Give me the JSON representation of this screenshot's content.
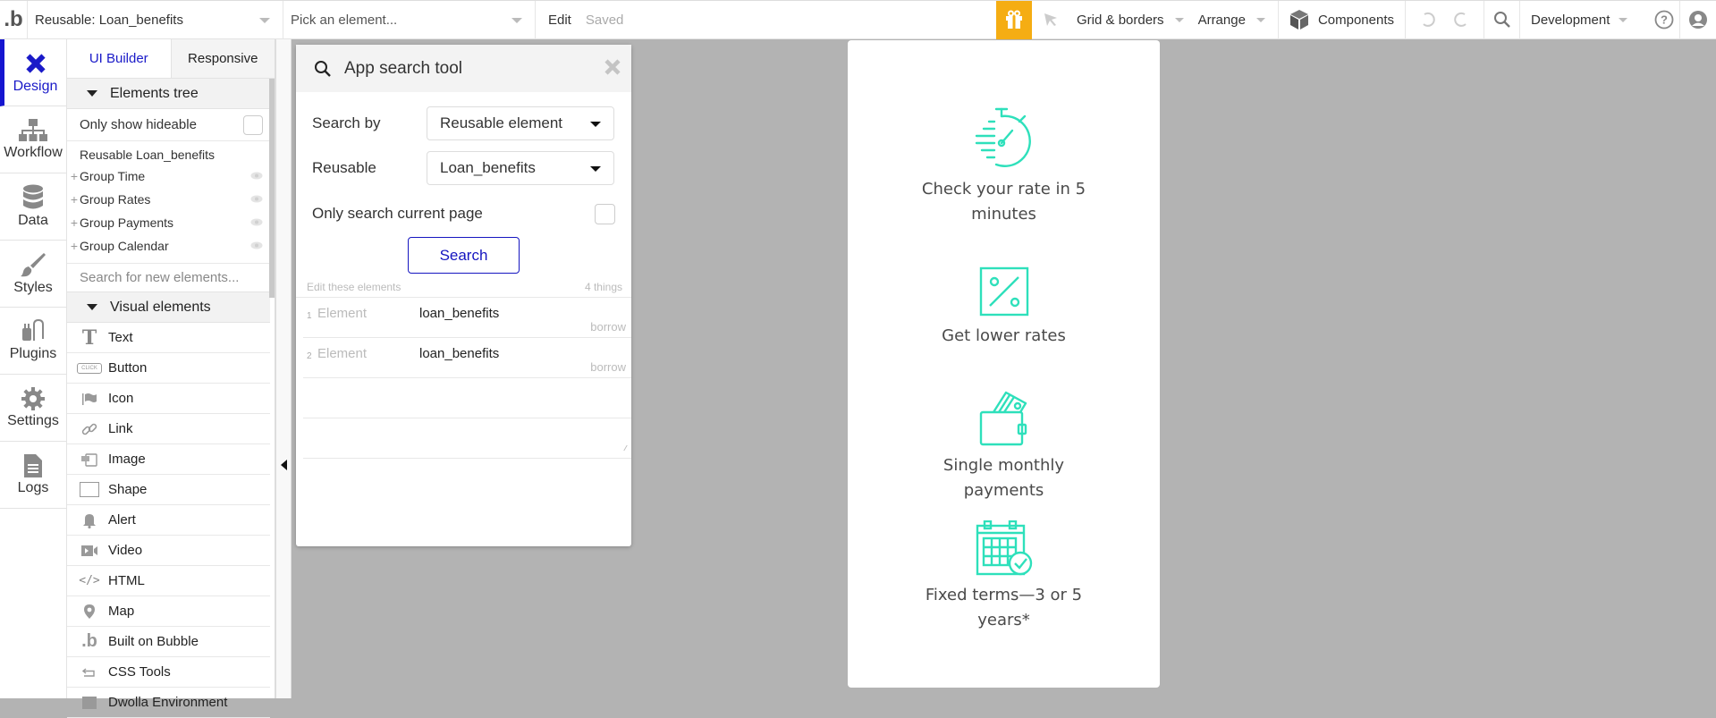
{
  "topbar": {
    "logo": ".b",
    "page_selector": "Reusable: Loan_benefits",
    "element_picker_placeholder": "Pick an element...",
    "edit_label": "Edit",
    "saved_label": "Saved",
    "gift_icon": "gift-icon",
    "grid_borders_label": "Grid & borders",
    "arrange_label": "Arrange",
    "components_label": "Components",
    "environment_label": "Development"
  },
  "rail": {
    "items": [
      {
        "label": "Design",
        "icon": "design-icon",
        "active": true
      },
      {
        "label": "Workflow",
        "icon": "workflow-icon"
      },
      {
        "label": "Data",
        "icon": "database-icon"
      },
      {
        "label": "Styles",
        "icon": "brush-icon"
      },
      {
        "label": "Plugins",
        "icon": "plug-icon"
      },
      {
        "label": "Settings",
        "icon": "gear-icon"
      },
      {
        "label": "Logs",
        "icon": "document-icon"
      }
    ]
  },
  "panel": {
    "tabs": [
      {
        "label": "UI Builder",
        "active": true
      },
      {
        "label": "Responsive"
      }
    ],
    "elements_tree_title": "Elements tree",
    "only_show_hideable": "Only show hideable",
    "tree_root": "Reusable Loan_benefits",
    "tree_items": [
      "Group Time",
      "Group Rates",
      "Group Payments",
      "Group Calendar"
    ],
    "search_placeholder": "Search for new elements...",
    "visual_elements_title": "Visual elements",
    "visual_elements": [
      {
        "label": "Text",
        "icon": "text-icon"
      },
      {
        "label": "Button",
        "icon": "button-icon"
      },
      {
        "label": "Icon",
        "icon": "flag-icon"
      },
      {
        "label": "Link",
        "icon": "link-icon"
      },
      {
        "label": "Image",
        "icon": "image-icon"
      },
      {
        "label": "Shape",
        "icon": "shape-icon"
      },
      {
        "label": "Alert",
        "icon": "bell-icon"
      },
      {
        "label": "Video",
        "icon": "video-icon"
      },
      {
        "label": "HTML",
        "icon": "code-icon"
      },
      {
        "label": "Map",
        "icon": "map-pin-icon"
      },
      {
        "label": "Built on Bubble",
        "icon": "bubble-logo-icon"
      },
      {
        "label": "CSS Tools",
        "icon": "css-tools-icon"
      },
      {
        "label": "Dwolla Environment",
        "icon": "dwolla-icon"
      }
    ],
    "button_icon_text": "CLICK"
  },
  "search_tool": {
    "title": "App search tool",
    "search_by_label": "Search by",
    "search_by_value": "Reusable element",
    "reusable_label": "Reusable",
    "reusable_value": "Loan_benefits",
    "only_current_page_label": "Only search current page",
    "search_button": "Search",
    "edit_these_label": "Edit these elements",
    "count_label": "4 things",
    "results": [
      {
        "num": "1",
        "type": "Element",
        "name": "loan_benefits",
        "page": "borrow"
      },
      {
        "num": "2",
        "type": "Element",
        "name": "loan_benefits",
        "page": "borrow"
      }
    ]
  },
  "canvas": {
    "accent_color": "#2ee0bb",
    "benefits": [
      {
        "icon": "stopwatch-icon",
        "label": "Check your rate in 5 minutes"
      },
      {
        "icon": "percent-icon",
        "label": "Get lower rates"
      },
      {
        "icon": "wallet-icon",
        "label": "Single monthly payments"
      },
      {
        "icon": "calendar-check-icon",
        "label": "Fixed terms—3 or 5 years*"
      }
    ]
  }
}
